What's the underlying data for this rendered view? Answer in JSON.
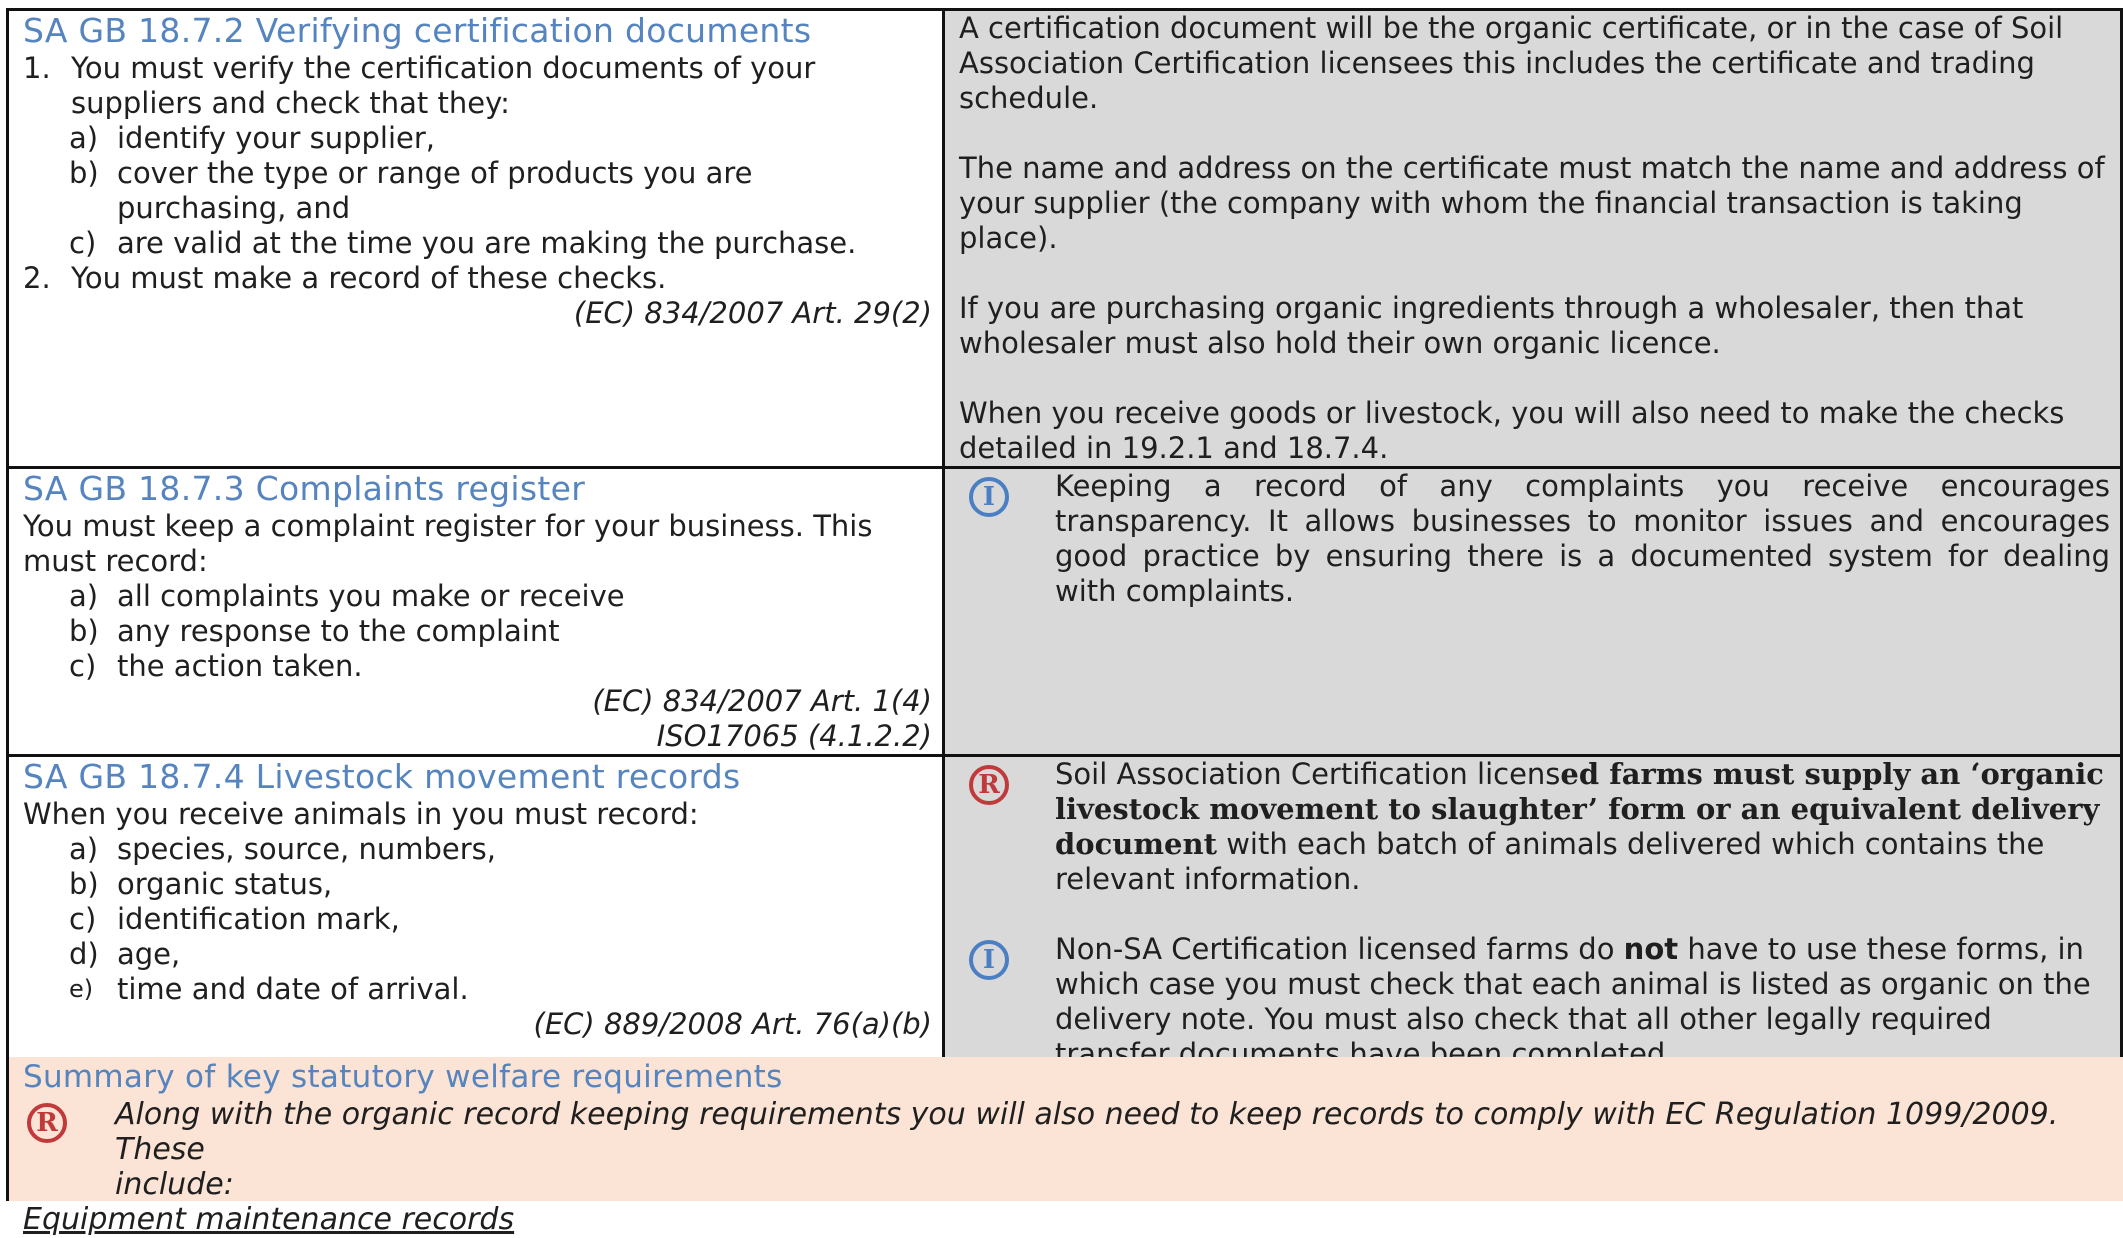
{
  "sections": [
    {
      "heading": "SA GB 18.7.2 Verifying certification documents",
      "item1_num": "1.",
      "item1_text_line1": "You must verify the certification documents of your",
      "item1_text_line2": "suppliers and check that they:",
      "sub_a_label": "a)",
      "sub_a_text": "identify your supplier,",
      "sub_b_label": "b)",
      "sub_b_text_line1": "cover the type or range of products you are",
      "sub_b_text_line2": "purchasing, and",
      "sub_c_label": "c)",
      "sub_c_text": "are valid at the time you are making the purchase.",
      "item2_num": "2.",
      "item2_text": "You must make a record of these checks.",
      "reference": "(EC) 834/2007 Art. 29(2)",
      "guidance": [
        "A certification document will be the organic certificate, or in the case of Soil Association Certification licensees this includes the certificate and trading schedule.",
        "The name and address on the certificate must match the name and address of your supplier (the company with whom the financial transaction is taking place).",
        "If you are purchasing organic ingredients through a wholesaler, then that wholesaler must also hold their own organic licence.",
        "When you receive goods or livestock, you will also need to make the checks detailed in 19.2.1 and 18.7.4."
      ]
    },
    {
      "heading": "SA GB 18.7.3 Complaints register",
      "intro": "You must keep a complaint register for your business. This must record:",
      "items": [
        {
          "label": "a)",
          "text": "all complaints you make or receive"
        },
        {
          "label": "b)",
          "text": "any response to the complaint"
        },
        {
          "label": "c)",
          "text": "the action taken."
        }
      ],
      "reference_1": "(EC) 834/2007 Art. 1(4)",
      "reference_2": "ISO17065 (4.1.2.2)",
      "info_icon_letter": "I",
      "info_text": "Keeping a record of any complaints you receive encourages transparency. It allows businesses to monitor issues and encourages good practice by ensuring there is a documented system for dealing with complaints."
    },
    {
      "heading": "SA GB 18.7.4 Livestock movement records",
      "intro": "When you receive animals in you must record:",
      "items": [
        {
          "label": "a)",
          "text": "species, source, numbers,"
        },
        {
          "label": "b)",
          "text": "organic status,"
        },
        {
          "label": "c)",
          "text": "identification mark,"
        },
        {
          "label": "d)",
          "text": "age,"
        },
        {
          "label": "e)",
          "text": "time and date of arrival."
        }
      ],
      "reference": "(EC) 889/2008 Art. 76(a)(b)",
      "req_icon_letter": "R",
      "req_text_plain": "Soil Association Certification licens",
      "req_text_bold": "ed farms must supply an ‘organic livestock movement to slaughter’ form or an equivalent delivery document",
      "req_text_tail": " with each batch of animals delivered which contains the relevant information.",
      "info_icon_letter": "I",
      "info_text_before": "Non-SA Certification licensed farms do ",
      "info_text_bold": "not",
      "info_text_after": " have to use these forms, in which case you must check that each animal is listed as organic on the delivery note. You must also check that all other legally required transfer documents have been completed."
    }
  ],
  "summary": {
    "heading": "Summary of key statutory welfare requirements",
    "req_icon_letter": "R",
    "text_line1": "Along with the organic record keeping requirements you will also need to keep records to comply with EC Regulation 1099/2009. These",
    "text_line2": "include:",
    "subheading": "Equipment maintenance records"
  },
  "colors": {
    "heading_blue": "#5584be",
    "guidance_grey": "#d9d9d9",
    "summary_peach": "#fbe4d5",
    "info_icon_blue": "#4a7fc4",
    "requirement_icon_red": "#c0393b"
  }
}
